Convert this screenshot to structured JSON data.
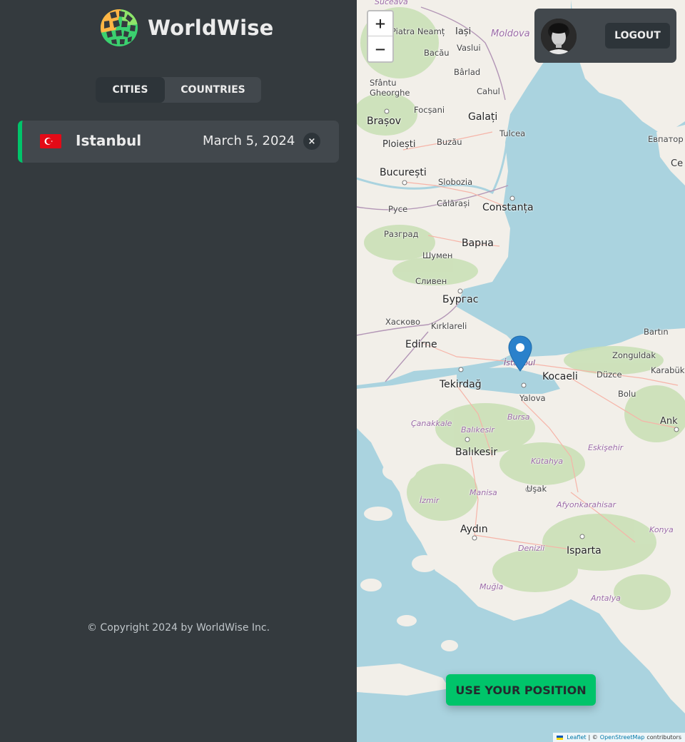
{
  "app": {
    "name": "WorldWise"
  },
  "tabs": [
    {
      "label": "CITIES",
      "active": true
    },
    {
      "label": "COUNTRIES",
      "active": false
    }
  ],
  "cities": [
    {
      "name": "Istanbul",
      "date": "March 5, 2024",
      "delete_label": "×",
      "flag": "turkey-flag"
    }
  ],
  "footer": {
    "copyright": "© Copyright 2024 by WorldWise Inc."
  },
  "map": {
    "zoom_in": "+",
    "zoom_out": "−",
    "use_position": "USE YOUR POSITION",
    "attribution": {
      "leaflet": "Leaflet",
      "separator": "| ©",
      "osm": "OpenStreetMap",
      "contributors": "contributors"
    },
    "labels": [
      "Suceava",
      "Piatra Neamț",
      "Iași",
      "Moldova",
      "Vaslui",
      "Bacău",
      "Bârlad",
      "Sfântu Gheorghe",
      "Cahul",
      "Focșani",
      "Galați",
      "Brașov",
      "Tulcea",
      "Ploiești",
      "Buzău",
      "Евпатор",
      "Се",
      "București",
      "Slobozia",
      "Călărași",
      "Constanța",
      "Русе",
      "Разград",
      "Варна",
      "Шумен",
      "Сливен",
      "Бургас",
      "Хасково",
      "Kırklareli",
      "Edirne",
      "Bartın",
      "Zonguldak",
      "Karabük",
      "Kocaeli",
      "Düzce",
      "Bolu",
      "Tekirdağ",
      "Yalova",
      "Bursa",
      "Çanakkale",
      "Balıkesir",
      "Ank",
      "Eskişehir",
      "Kütahya",
      "Manisa",
      "Uşak",
      "İzmir",
      "Afyonkarahisar",
      "Aydın",
      "Konya",
      "Denizli",
      "Isparta",
      "Muğla",
      "Antalya",
      "İstanbul"
    ]
  },
  "user": {
    "logout_label": "LOGOUT"
  },
  "colors": {
    "brand_green": "#00c46a",
    "sidebar_bg": "#343a3e",
    "panel_bg": "#42484d",
    "dark_bg": "#2d3439",
    "marker_blue": "#2a81cb"
  }
}
